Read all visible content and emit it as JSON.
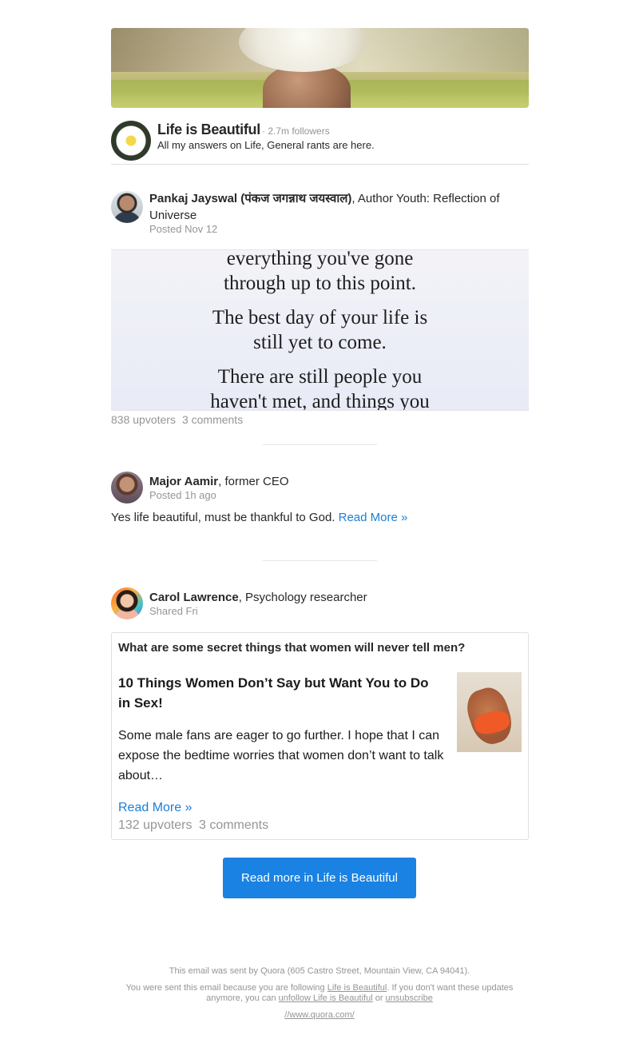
{
  "space": {
    "name": "Life is Beautiful",
    "followers": "· 2.7m followers",
    "description": "All my answers on Life, General rants are here."
  },
  "posts": [
    {
      "author": "Pankaj Jayswal (पंकज जगन्नाथ जयस्वाल)",
      "credential": ", Author Youth: Reflection of Universe",
      "meta": "Posted Nov 12",
      "quote_lines": [
        "everything you've gone",
        "through up to this point.",
        "The best day of your life is",
        "still yet to come.",
        "There are still people you",
        "haven't met, and things you"
      ],
      "upvoters": "838 upvoters",
      "comments": "3 comments"
    },
    {
      "author": "Major Aamir",
      "credential": ", former CEO",
      "meta": "Posted 1h ago",
      "text": "Yes life beautiful, must be thankful to God.",
      "read_more": "Read More »"
    },
    {
      "author": "Carol Lawrence",
      "credential": ", Psychology researcher",
      "meta": "Shared Fri",
      "card": {
        "question": "What are some secret things that women will never tell men?",
        "title": "10 Things Women Don’t Say but Want You to Do in Sex!",
        "excerpt": "Some male fans are eager to go further. I hope that I can expose the bedtime worries that women don’t want to talk about…",
        "read_more": "Read More »",
        "upvoters": "132 upvoters",
        "comments": "3 comments"
      }
    }
  ],
  "cta": {
    "label": "Read more in Life is Beautiful"
  },
  "footer": {
    "sent_by": "This email was sent by Quora (605 Castro Street, Mountain View, CA 94041).",
    "reason_pre": "You were sent this email because you are following ",
    "space_link": "Life is Beautiful",
    "reason_mid": ". If you don't want these updates",
    "reason_line2_pre": "anymore, you can ",
    "unfollow_link": "unfollow Life is Beautiful",
    "or": " or ",
    "unsubscribe_link": "unsubscribe",
    "url": "//www.quora.com/"
  }
}
